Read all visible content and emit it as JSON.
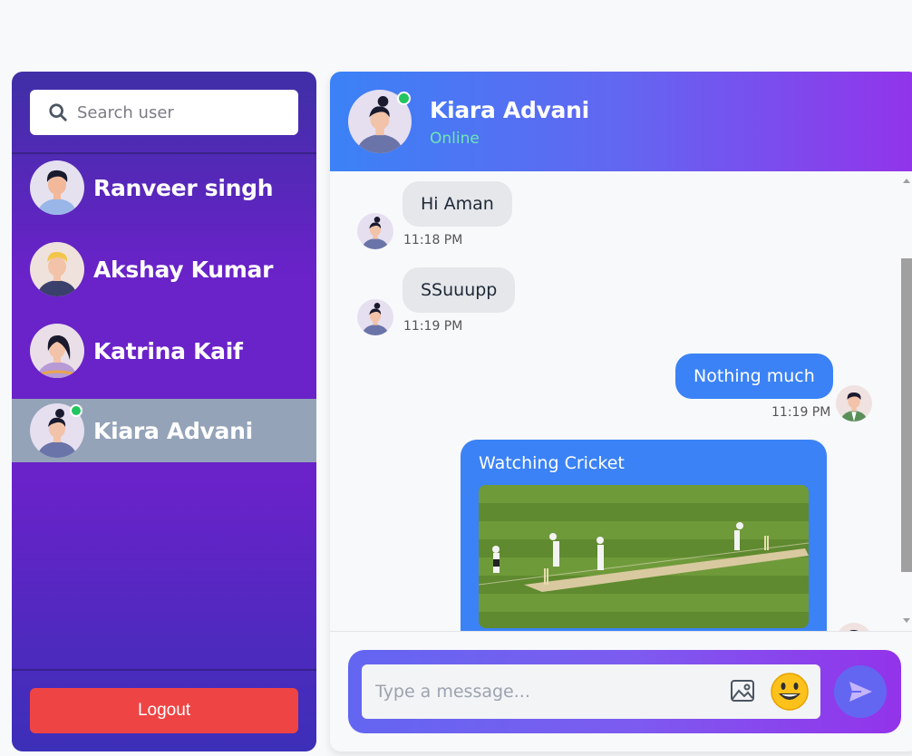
{
  "sidebar": {
    "search": {
      "placeholder": "Search user"
    },
    "contacts": [
      {
        "name": "Ranveer singh",
        "active": false,
        "online": false
      },
      {
        "name": "Akshay Kumar",
        "active": false,
        "online": false
      },
      {
        "name": "Katrina Kaif",
        "active": false,
        "online": false
      },
      {
        "name": "Kiara Advani",
        "active": true,
        "online": true
      }
    ],
    "logout_label": "Logout"
  },
  "chat": {
    "header": {
      "name": "Kiara Advani",
      "status": "Online"
    },
    "messages": [
      {
        "direction": "incoming",
        "text": "Hi Aman",
        "time": "11:18 PM"
      },
      {
        "direction": "incoming",
        "text": "SSuuupp",
        "time": "11:19 PM"
      },
      {
        "direction": "outgoing",
        "text": "Nothing much",
        "time": "11:19 PM"
      },
      {
        "direction": "outgoing",
        "text": "Watching Cricket",
        "has_image": true,
        "image_subject": "cricket match on green field"
      }
    ],
    "composer": {
      "placeholder": "Type a message..."
    }
  },
  "colors": {
    "sidebar_gradient": [
      "#3f2fa6",
      "#6a22c9"
    ],
    "active_contact_bg": "#94a3b8",
    "online": "#22c55e",
    "online_text": "#6ee7b7",
    "outgoing_bubble": "#3b82f6",
    "incoming_bubble": "#e5e7eb",
    "logout": "#ef4444",
    "header_gradient": [
      "#3b82f6",
      "#9333ea"
    ]
  },
  "icons": [
    "search-icon",
    "image-icon",
    "emoji-icon",
    "send-icon"
  ]
}
